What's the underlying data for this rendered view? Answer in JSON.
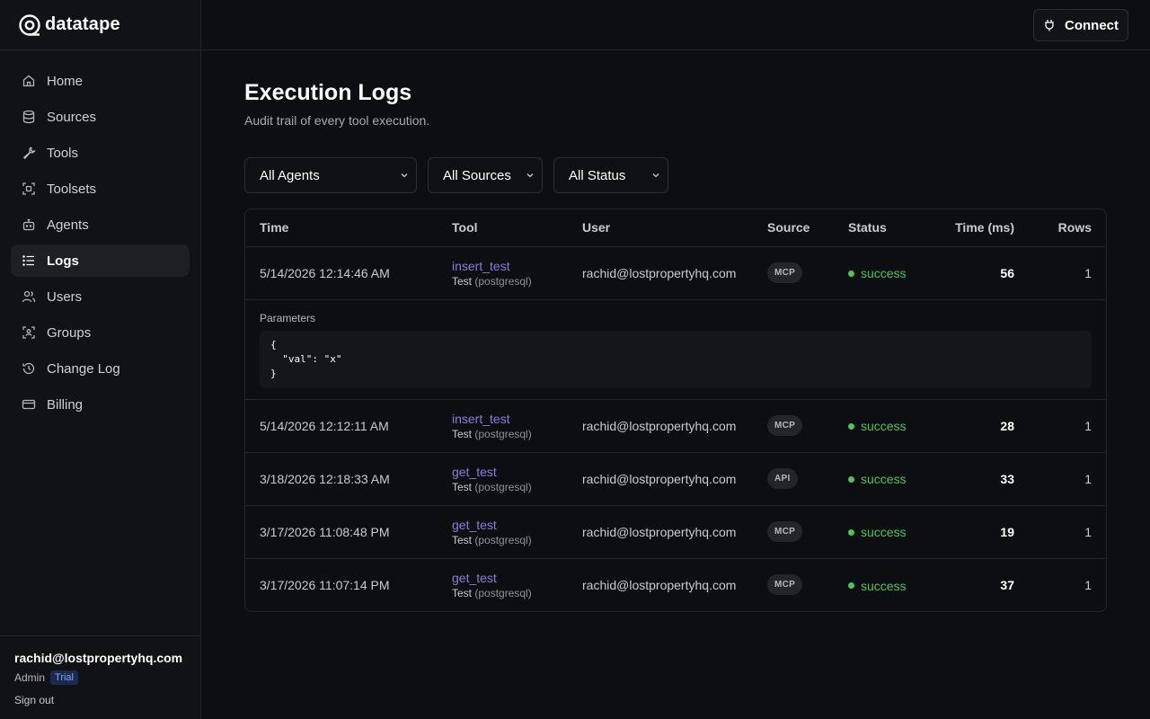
{
  "brand": {
    "name": "datatape"
  },
  "topbar": {
    "connect_label": "Connect"
  },
  "sidebar": {
    "items": [
      {
        "label": "Home",
        "icon": "home-icon"
      },
      {
        "label": "Sources",
        "icon": "database-icon"
      },
      {
        "label": "Tools",
        "icon": "wrench-icon"
      },
      {
        "label": "Toolsets",
        "icon": "scan-icon"
      },
      {
        "label": "Agents",
        "icon": "bot-icon"
      },
      {
        "label": "Logs",
        "icon": "list-icon",
        "active": true
      },
      {
        "label": "Users",
        "icon": "users-icon"
      },
      {
        "label": "Groups",
        "icon": "group-icon"
      },
      {
        "label": "Change Log",
        "icon": "history-icon"
      },
      {
        "label": "Billing",
        "icon": "credit-card-icon"
      }
    ],
    "user": {
      "email": "rachid@lostpropertyhq.com",
      "role": "Admin",
      "plan_badge": "Trial",
      "sign_out": "Sign out"
    }
  },
  "main": {
    "title": "Execution Logs",
    "subtitle": "Audit trail of every tool execution.",
    "filters": [
      {
        "selected": "All Agents"
      },
      {
        "selected": "All Sources"
      },
      {
        "selected": "All Status"
      }
    ],
    "table": {
      "headers": [
        "Time",
        "Tool",
        "User",
        "Source",
        "Status",
        "Time (ms)",
        "Rows"
      ],
      "params_label": "Parameters",
      "params_json": "{\n  \"val\": \"x\"\n}",
      "rows": [
        {
          "time": "5/14/2026 12:14:46 AM",
          "tool": "insert_test",
          "tool_source": "Test",
          "engine": "(postgresql)",
          "user": "rachid@lostpropertyhq.com",
          "source": "MCP",
          "status": "success",
          "ms": "56",
          "rows": "1"
        },
        {
          "time": "5/14/2026 12:12:11 AM",
          "tool": "insert_test",
          "tool_source": "Test",
          "engine": "(postgresql)",
          "user": "rachid@lostpropertyhq.com",
          "source": "MCP",
          "status": "success",
          "ms": "28",
          "rows": "1"
        },
        {
          "time": "3/18/2026 12:18:33 AM",
          "tool": "get_test",
          "tool_source": "Test",
          "engine": "(postgresql)",
          "user": "rachid@lostpropertyhq.com",
          "source": "API",
          "status": "success",
          "ms": "33",
          "rows": "1"
        },
        {
          "time": "3/17/2026 11:08:48 PM",
          "tool": "get_test",
          "tool_source": "Test",
          "engine": "(postgresql)",
          "user": "rachid@lostpropertyhq.com",
          "source": "MCP",
          "status": "success",
          "ms": "19",
          "rows": "1"
        },
        {
          "time": "3/17/2026 11:07:14 PM",
          "tool": "get_test",
          "tool_source": "Test",
          "engine": "(postgresql)",
          "user": "rachid@lostpropertyhq.com",
          "source": "MCP",
          "status": "success",
          "ms": "37",
          "rows": "1"
        }
      ]
    }
  }
}
